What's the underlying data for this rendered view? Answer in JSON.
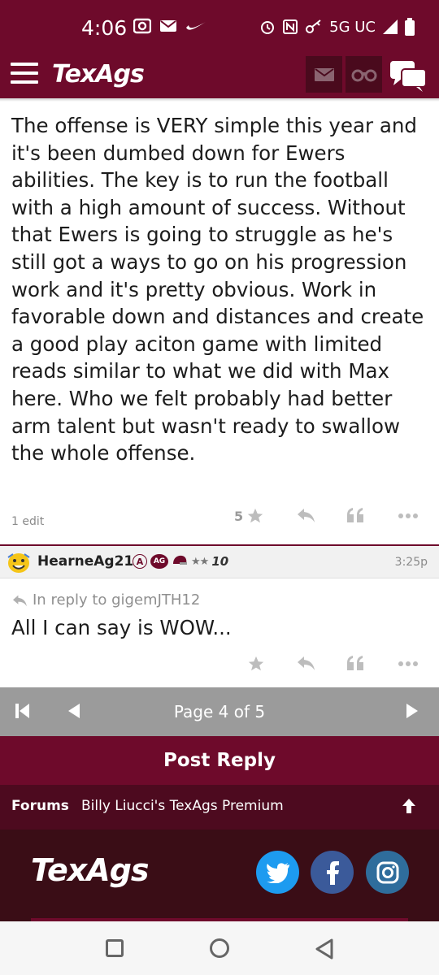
{
  "status_bar": {
    "time": "4:06",
    "network": "5G UC"
  },
  "header": {
    "logo": "TexAgs"
  },
  "post1": {
    "body": "The offense is VERY simple this year and it's been dumbed down for Ewers abilities. The key is to run the football with a high amount of success. Without that Ewers is going to struggle as he's still got a ways to go on his progression work and it's pretty obvious. Work in favorable down and distances and create a good play aciton game with limited reads similar to what we did with Max here. Who we felt probably had better arm talent but wasn't ready to swallow the whole offense.",
    "edit_count": "1 edit",
    "like_count": "5"
  },
  "post2": {
    "username": "HearneAg21",
    "badge_a": "A",
    "badge_ag": "AG",
    "badge_stars": "★★",
    "badge_10": "10",
    "time": "3:25p",
    "reply_to": "In reply to gigemJTH12",
    "body": "All I can say is WOW..."
  },
  "pagination": {
    "label": "Page 4 of 5"
  },
  "post_reply_label": "Post Reply",
  "breadcrumb": {
    "forums": "Forums",
    "forum_name": "Billy Liucci's TexAgs Premium"
  },
  "footer": {
    "logo": "TexAgs"
  },
  "colors": {
    "maroon": "#6e0a2b",
    "dark_maroon": "#4d0a1f",
    "footer_bg": "#3a0d16",
    "pager_gray": "#9b9b9b"
  }
}
